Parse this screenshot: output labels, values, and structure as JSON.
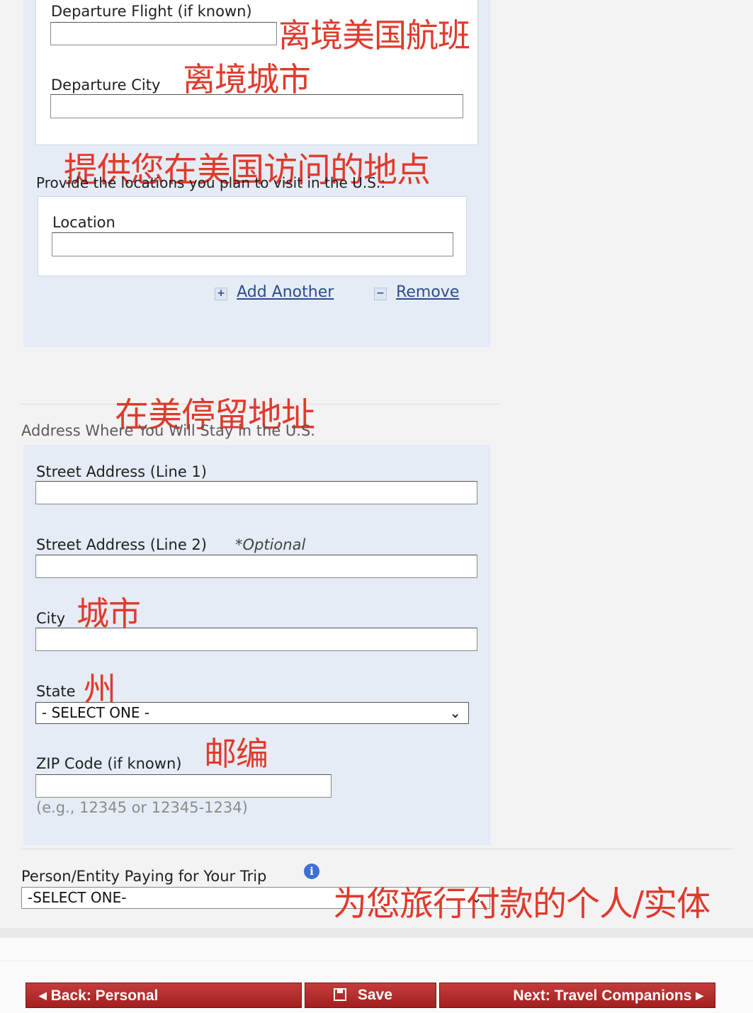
{
  "flight_section": {
    "departure_flight_label": "Departure Flight (if known)",
    "departure_flight_value": "",
    "departure_flight_cn": "离境美国航班",
    "departure_city_label": "Departure City",
    "departure_city_value": "",
    "departure_city_cn": "离境城市"
  },
  "locations_section": {
    "prompt_label": "Provide the locations you plan to visit in the U.S.:",
    "prompt_cn": "提供您在美国访问的地点",
    "location_label": "Location",
    "location_value": "",
    "add_another": "Add Another",
    "remove": "Remove"
  },
  "address_section": {
    "heading": "Address Where You Will Stay in the U.S.",
    "heading_cn": "在美停留地址",
    "street1_label": "Street Address (Line 1)",
    "street1_value": "",
    "street2_label": "Street Address (Line 2)",
    "street2_optional": "*Optional",
    "street2_value": "",
    "city_label": "City",
    "city_cn": "城市",
    "city_value": "",
    "state_label": "State",
    "state_cn": "州",
    "state_selected": "- SELECT ONE -",
    "zip_label": "ZIP Code (if known)",
    "zip_cn": "邮编",
    "zip_value": "",
    "zip_hint": "(e.g., 12345 or 12345-1234)"
  },
  "payer_section": {
    "label": "Person/Entity Paying for Your Trip",
    "selected": "-SELECT ONE-",
    "cn": "为您旅行付款的个人/实体"
  },
  "nav": {
    "back_label": "Back: Personal",
    "save_label": "Save",
    "next_label": "Next: Travel Companions"
  },
  "colors": {
    "annotation_red": "#e03a2c",
    "panel_blue": "#e6ecf5",
    "button_red": "#b52a2a",
    "link_blue": "#2a4d8e"
  }
}
